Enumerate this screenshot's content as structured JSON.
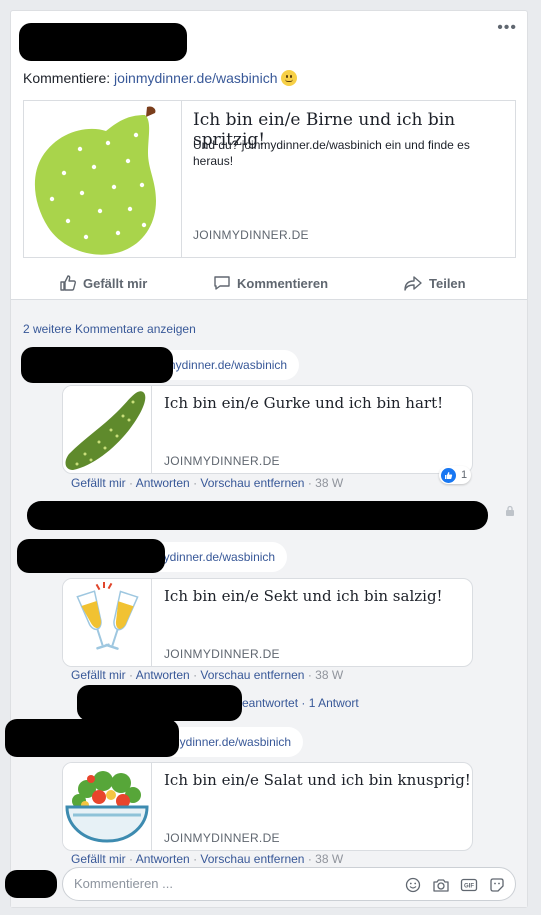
{
  "post": {
    "text_prefix": "Kommentiere: ",
    "link": "joinmydinner.de/wasbinich",
    "more_icon": "more-horizontal-icon",
    "preview": {
      "title": "Ich bin ein/e Birne und ich bin spritzig!",
      "description": "Und du? joinmydinner.de/wasbinich ein und finde es heraus!",
      "domain": "JOINMYDINNER.DE"
    }
  },
  "actions": {
    "like": "Gefällt mir",
    "comment": "Kommentieren",
    "share": "Teilen"
  },
  "more_comments": "2 weitere Kommentare anzeigen",
  "comments": [
    {
      "link": "joinmydinner.de/wasbinich",
      "preview_title": "Ich bin ein/e Gurke und ich bin hart!",
      "preview_domain": "JOINMYDINNER.DE",
      "actions": [
        "Gefällt mir",
        "Antworten",
        "Vorschau entfernen"
      ],
      "time": "38 W",
      "reactions": "1"
    },
    {
      "link": "joinmydinner.de/wasbinich",
      "preview_title": "Ich bin ein/e Sekt und ich bin salzig!",
      "preview_domain": "JOINMYDINNER.DE",
      "actions": [
        "Gefällt mir",
        "Antworten",
        "Vorschau entfernen"
      ],
      "time": "38 W"
    },
    {
      "link": "joinmydinner.de/wasbinich",
      "preview_title": "Ich bin ein/e Salat und ich bin knusprig!",
      "preview_domain": "JOINMYDINNER.DE",
      "actions": [
        "Gefällt mir",
        "Antworten",
        "Vorschau entfernen"
      ],
      "time": "38 W"
    }
  ],
  "reply_summary": {
    "suffix": "eantwortet",
    "count": "1 Antwort"
  },
  "comment_input": {
    "placeholder": "Kommentieren ..."
  },
  "colors": {
    "link": "#385898",
    "background": "#e9ebee",
    "comments_bg": "#f2f3f5"
  }
}
